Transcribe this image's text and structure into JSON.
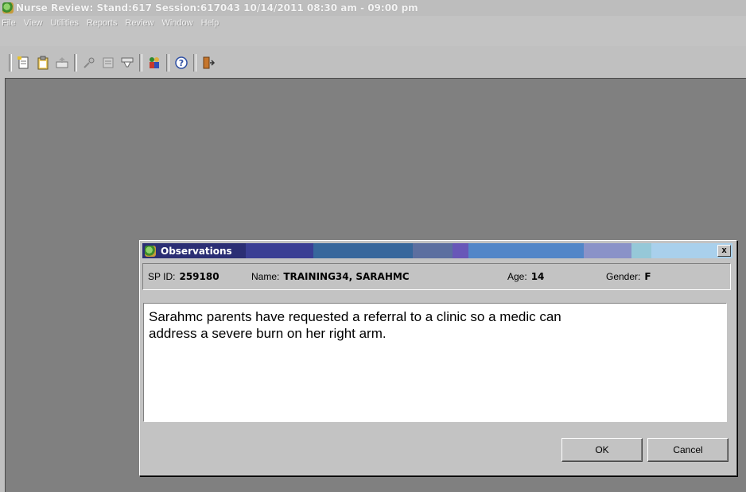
{
  "window": {
    "title": "Nurse Review: Stand:617 Session:617043 10/14/2011 08:30 am - 09:00 pm"
  },
  "menu": [
    "File",
    "View",
    "Utilities",
    "Reports",
    "Review",
    "Window",
    "Help"
  ],
  "toolbar": {
    "icons": [
      "new-record-icon",
      "clipboard-icon",
      "export-icon",
      "connect-icon",
      "list-icon",
      "filter-icon",
      "people-icon",
      "help-icon",
      "exit-icon"
    ]
  },
  "dialog": {
    "title": "Observations",
    "close_label": "x",
    "sp_id_label": "SP ID:",
    "sp_id": "259180",
    "name_label": "Name:",
    "name": "TRAINING34, SARAHMC",
    "age_label": "Age:",
    "age": "14",
    "gender_label": "Gender:",
    "gender": "F",
    "observation_text": "Sarahmc parents have requested a referral to a clinic so a medic can\naddress a severe burn on her right arm.",
    "ok_label": "OK",
    "cancel_label": "Cancel"
  }
}
